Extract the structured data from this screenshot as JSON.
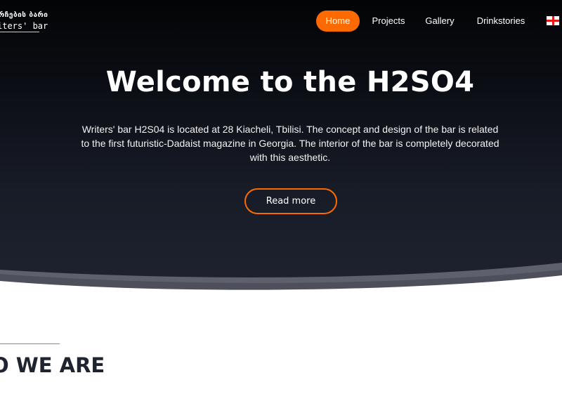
{
  "logo": {
    "top_text": "რჩების ბარი",
    "bottom_text": "iters' bar"
  },
  "nav": {
    "items": [
      "Home",
      "Projects",
      "Gallery",
      "Drinkstories"
    ],
    "active": "Home",
    "active_color": "#ff6a00"
  },
  "language": {
    "icon": "georgian-flag-icon"
  },
  "hero": {
    "title": "Welcome to the H2SO4",
    "description": "Writers' bar H2S04 is located at 28 Kiacheli, Tbilisi. The concept and design of the bar is related to the first futuristic-Dadaist magazine in Georgia. The interior of the bar is completely decorated with this aesthetic.",
    "button_label": "Read more"
  },
  "section": {
    "title": "O WE ARE"
  },
  "colors": {
    "accent": "#ff6a00",
    "hero_bg": "#111520",
    "heading_dark": "#1e2430"
  }
}
